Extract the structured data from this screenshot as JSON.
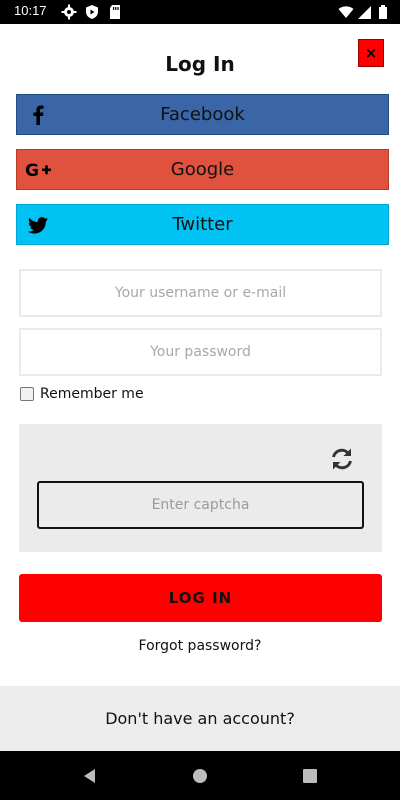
{
  "status_bar": {
    "time": "10:17",
    "left_icons": [
      "settings-icon",
      "shield-icon",
      "sd-card-icon"
    ],
    "right_icons": [
      "wifi-icon",
      "signal-icon",
      "battery-icon"
    ]
  },
  "dialog": {
    "title": "Log In",
    "close_label": "×"
  },
  "social": {
    "facebook": {
      "label": "Facebook",
      "icon": "facebook-icon",
      "color": "#3a66a8"
    },
    "google": {
      "label": "Google",
      "icon": "google-plus-icon",
      "color": "#e0523d"
    },
    "twitter": {
      "label": "Twitter",
      "icon": "twitter-icon",
      "color": "#00c3f3"
    }
  },
  "form": {
    "username_placeholder": "Your username or e-mail",
    "username_value": "",
    "password_placeholder": "Your password",
    "password_value": "",
    "remember_label": "Remember me",
    "remember_checked": false,
    "captcha_placeholder": "Enter captcha",
    "captcha_value": "",
    "refresh_icon": "refresh-icon",
    "login_label": "LOG IN",
    "login_color": "#ff0000"
  },
  "links": {
    "forgot_password": "Forgot password?",
    "signup_prompt": "Don't have an account?"
  },
  "nav_bar": {
    "icons": [
      "back-icon",
      "home-icon",
      "recents-icon"
    ]
  }
}
